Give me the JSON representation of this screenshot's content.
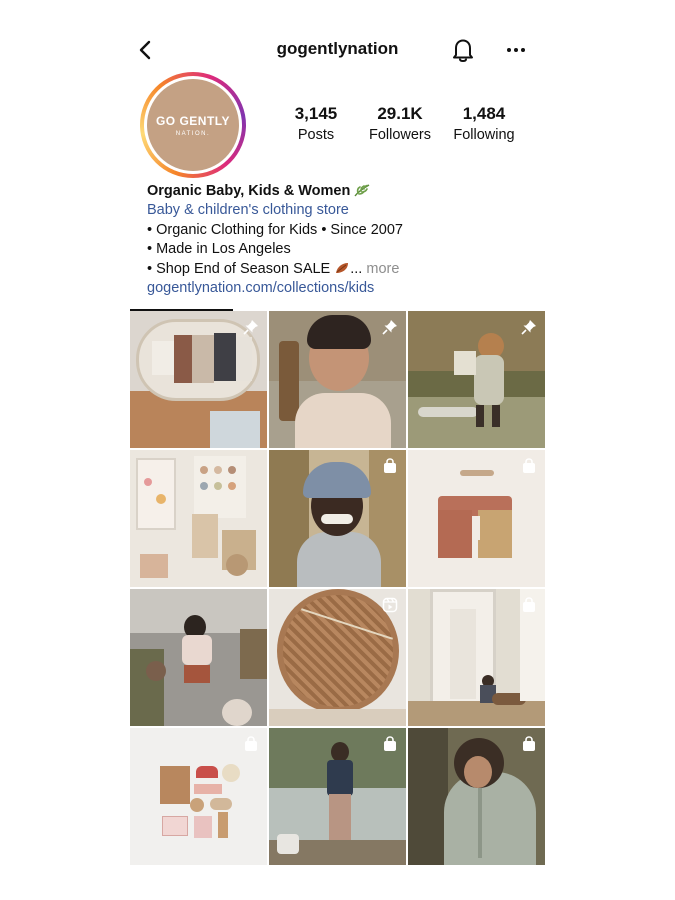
{
  "header": {
    "username": "gogentlynation",
    "back_icon": "chevron-left-icon",
    "bell_icon": "bell-icon",
    "more_icon": "ellipsis-icon"
  },
  "profile": {
    "avatar_line1": "GO GENTLY",
    "avatar_line2": "NATION.",
    "stats": [
      {
        "value": "3,145",
        "label": "Posts"
      },
      {
        "value": "29.1K",
        "label": "Followers"
      },
      {
        "value": "1,484",
        "label": "Following"
      }
    ]
  },
  "bio": {
    "name": "Organic Baby, Kids & Women",
    "category": "Baby & children's clothing store",
    "line1": "• Organic Clothing for Kids • Since 2007",
    "line2": "• Made in Los Angeles",
    "line3": "• Shop End of Season SALE",
    "ellipsis": "...",
    "more": "more",
    "link": "gogentlynation.com/collections/kids"
  },
  "colors": {
    "link": "#385898",
    "muted": "#8e8e8e",
    "avatar_bg": "#c4a184"
  },
  "posts": [
    {
      "badge": "pin-icon"
    },
    {
      "badge": "pin-icon"
    },
    {
      "badge": "pin-icon"
    },
    {
      "badge": ""
    },
    {
      "badge": "shopping-bag-icon"
    },
    {
      "badge": "shopping-bag-icon"
    },
    {
      "badge": ""
    },
    {
      "badge": "reels-icon"
    },
    {
      "badge": "shopping-bag-icon"
    },
    {
      "badge": "shopping-bag-icon"
    },
    {
      "badge": "shopping-bag-icon"
    },
    {
      "badge": "shopping-bag-icon"
    }
  ]
}
